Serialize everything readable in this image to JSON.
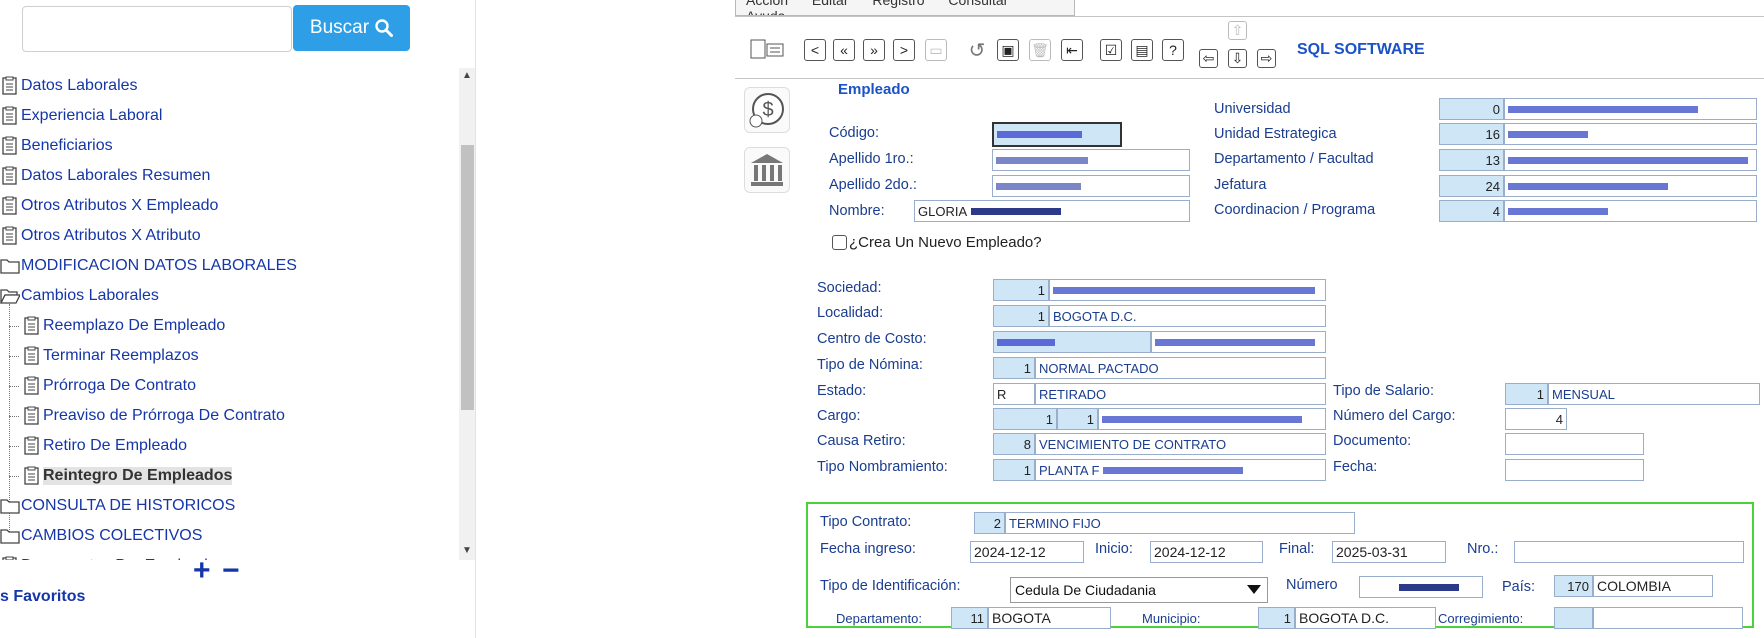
{
  "search": {
    "button_label": "Buscar",
    "value": ""
  },
  "tree": {
    "items": [
      {
        "label": "Datos Laborales",
        "icon": "document-icon",
        "level": 0
      },
      {
        "label": "Experiencia Laboral",
        "icon": "document-icon",
        "level": 0
      },
      {
        "label": "Beneficiarios",
        "icon": "document-icon",
        "level": 0
      },
      {
        "label": "Datos Laborales Resumen",
        "icon": "document-icon",
        "level": 0
      },
      {
        "label": "Otros Atributos X Empleado",
        "icon": "document-icon",
        "level": 0
      },
      {
        "label": "Otros Atributos X Atributo",
        "icon": "document-icon",
        "level": 0
      },
      {
        "label": "MODIFICACION DATOS LABORALES",
        "icon": "folder-icon",
        "level": 0
      },
      {
        "label": "Cambios Laborales",
        "icon": "folder-open-icon",
        "level": 0
      },
      {
        "label": "Reemplazo De Empleado",
        "icon": "document-icon",
        "level": 1
      },
      {
        "label": "Terminar Reemplazos",
        "icon": "document-icon",
        "level": 1
      },
      {
        "label": "Prórroga De Contrato",
        "icon": "document-icon",
        "level": 1
      },
      {
        "label": "Preaviso de Prórroga De Contrato",
        "icon": "document-icon",
        "level": 1
      },
      {
        "label": "Retiro De Empleado",
        "icon": "document-icon",
        "level": 1
      },
      {
        "label": "Reintegro De Empleados",
        "icon": "document-icon",
        "level": 1,
        "selected": true
      },
      {
        "label": "CONSULTA DE HISTORICOS",
        "icon": "folder-icon",
        "level": 0
      },
      {
        "label": "CAMBIOS COLECTIVOS",
        "icon": "folder-icon",
        "level": 0
      },
      {
        "label": "Documentos Por Empleado",
        "icon": "document-icon",
        "level": 0
      }
    ],
    "expand_label": "+",
    "collapse_label": "−"
  },
  "favorites_label": "s Favoritos",
  "menu": [
    "Acción",
    "Editar",
    "Registro",
    "Consultar",
    "Ayuda"
  ],
  "brand": "SQL SOFTWARE",
  "section_title": "Empleado",
  "employee": {
    "codigo_label": "Código:",
    "apellido1_label": "Apellido 1ro.:",
    "apellido2_label": "Apellido 2do.:",
    "nombre_label": "Nombre:",
    "nombre_value": "GLORIA"
  },
  "org": {
    "universidad_label": "Universidad",
    "universidad_code": "0",
    "unidad_label": "Unidad Estrategica",
    "unidad_code": "16",
    "depto_label": "Departamento / Facultad",
    "depto_code": "13",
    "jefatura_label": "Jefatura",
    "jefatura_code": "24",
    "coord_label": "Coordinacion / Programa",
    "coord_code": "4"
  },
  "new_employee_label": "¿Crea Un Nuevo Empleado?",
  "labor": {
    "sociedad_label": "Sociedad:",
    "sociedad_code": "1",
    "localidad_label": "Localidad:",
    "localidad_code": "1",
    "localidad_value": "BOGOTA D.C.",
    "centro_label": "Centro de Costo:",
    "tipo_nomina_label": "Tipo de Nómina:",
    "tipo_nomina_code": "1",
    "tipo_nomina_value": "NORMAL PACTADO",
    "estado_label": "Estado:",
    "estado_code": "R",
    "estado_value": "RETIRADO",
    "cargo_label": "Cargo:",
    "cargo_code": "1",
    "cargo_code2": "1",
    "causa_label": "Causa Retiro:",
    "causa_code": "8",
    "causa_value": "VENCIMIENTO DE CONTRATO",
    "tipo_nomb_label": "Tipo Nombramiento:",
    "tipo_nomb_code": "1",
    "tipo_nomb_value": "PLANTA F",
    "tipo_salario_label": "Tipo de Salario:",
    "tipo_salario_code": "1",
    "tipo_salario_value": "MENSUAL",
    "numero_cargo_label": "Número del Cargo:",
    "numero_cargo_value": "4",
    "documento_label": "Documento:",
    "fecha_label": "Fecha:"
  },
  "contract": {
    "tipo_label": "Tipo Contrato:",
    "tipo_code": "2",
    "tipo_value": "TERMINO FIJO",
    "ingreso_label": "Fecha ingreso:",
    "ingreso_value": "2024-12-12",
    "inicio_label": "Inicio:",
    "inicio_value": "2024-12-12",
    "final_label": "Final:",
    "final_value": "2025-03-31",
    "nro_label": "Nro.:",
    "tipo_id_label": "Tipo de Identificación:",
    "tipo_id_value": "Cedula De Ciudadania",
    "numero_label": "Número",
    "pais_label": "País:",
    "pais_code": "170",
    "pais_value": "COLOMBIA",
    "depto_label": "Departamento:",
    "depto_code": "11",
    "depto_value": "BOGOTA",
    "municipio_label": "Municipio:",
    "municipio_code": "1",
    "municipio_value": "BOGOTA D.C.",
    "corregimiento_label": "Corregimiento:"
  },
  "colors": {
    "accent": "#2e9ee6",
    "label_blue": "#1a3d8f",
    "field_fill": "#cfe6f7",
    "highlight_border": "#4cd13a"
  }
}
